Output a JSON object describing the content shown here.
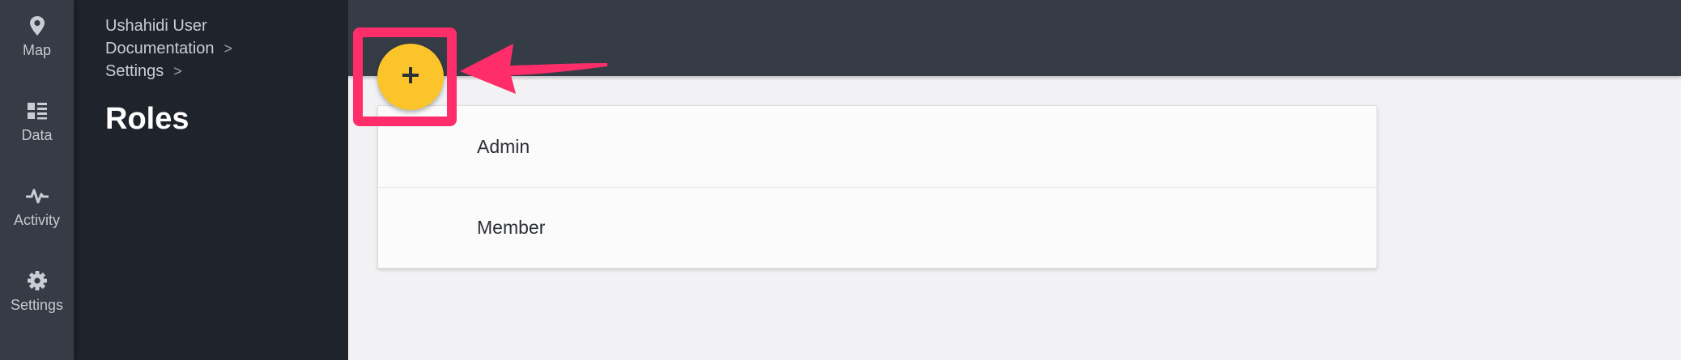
{
  "nav": {
    "items": [
      {
        "label": "Map",
        "icon": "map-pin-icon"
      },
      {
        "label": "Data",
        "icon": "data-list-icon"
      },
      {
        "label": "Activity",
        "icon": "activity-pulse-icon"
      },
      {
        "label": "Settings",
        "icon": "gear-icon"
      }
    ]
  },
  "breadcrumb": {
    "items": [
      {
        "label": "Ushahidi User Documentation",
        "separator": ">"
      },
      {
        "label": "Settings",
        "separator": ">"
      }
    ]
  },
  "page": {
    "title": "Roles"
  },
  "fab": {
    "icon": "plus-icon",
    "color": "#fcc42b"
  },
  "roles": {
    "items": [
      {
        "name": "Admin"
      },
      {
        "name": "Member"
      }
    ]
  },
  "annotation": {
    "color": "#ff2e6a"
  }
}
